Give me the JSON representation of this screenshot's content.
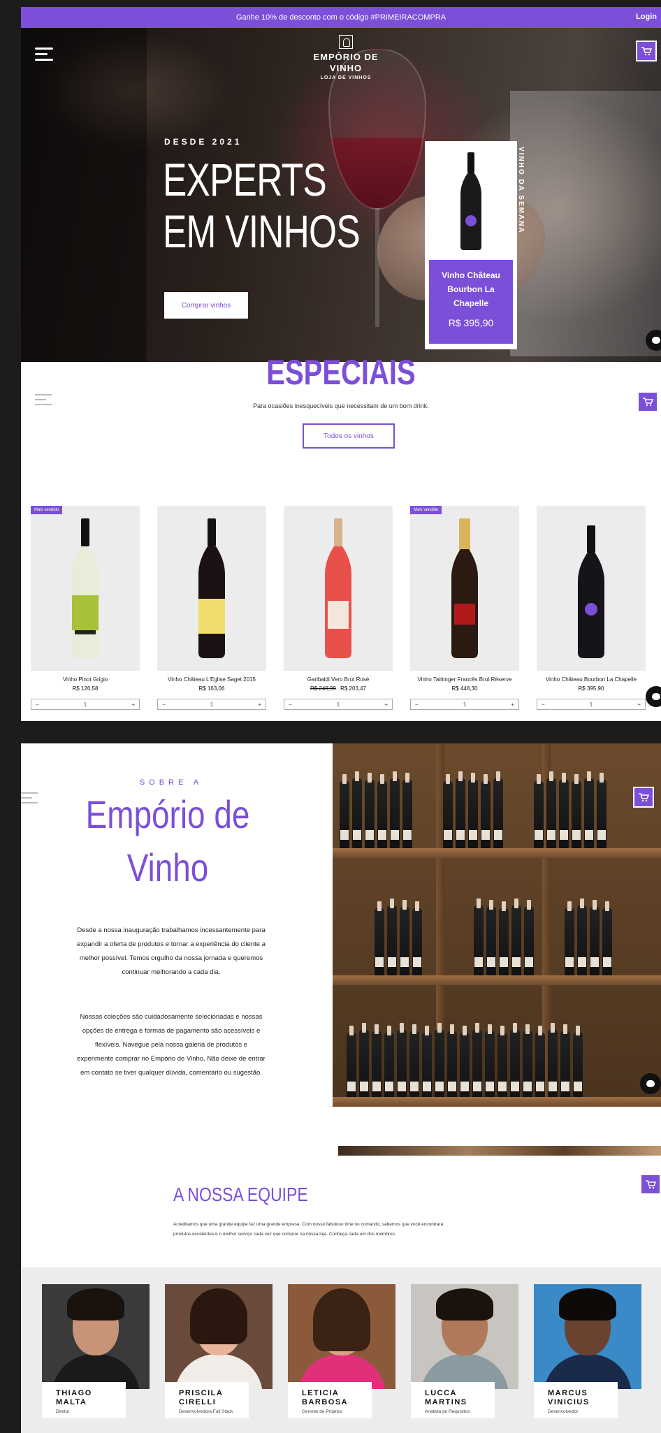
{
  "promo": {
    "text": "Ganhe 10% de desconto com o código #PRIMEIRACOMPRA",
    "login": "Login"
  },
  "brand": {
    "line1": "EMPÓRIO DE",
    "line2": "VINHO",
    "line3": "LOJA DE VINHOS"
  },
  "hero": {
    "eyebrow": "DESDE 2021",
    "title_line1": "EXPERTS",
    "title_line2": "EM VINHOS",
    "cta": "Comprar vinhos"
  },
  "wine_of_week": {
    "label": "VINHO DA SEMANA",
    "name": "Vinho Château Bourbon La Chapelle",
    "price": "R$ 395,90"
  },
  "especiais": {
    "title": "ESPECIAIS",
    "subtitle": "Para ocasiões inesquecíveis que necessitam de um bom drink.",
    "button": "Todos os vinhos",
    "badge": "Mais vendido",
    "products": [
      {
        "name": "Vinho Pinot Grigio",
        "price": "R$ 126,58",
        "old_price": "",
        "qty": "1",
        "badge": true
      },
      {
        "name": "Vinho Château L'Eglise Saget 2015",
        "price": "R$ 163,06",
        "old_price": "",
        "qty": "1",
        "badge": false
      },
      {
        "name": "Garibaldi Vero Brut Rosé",
        "price": "R$ 203,47",
        "old_price": "R$ 249,99",
        "qty": "1",
        "badge": false
      },
      {
        "name": "Vinho Taittinger Francês Brut Réserve",
        "price": "R$ 448,30",
        "old_price": "",
        "qty": "1",
        "badge": true
      },
      {
        "name": "Vinho Château Bourbon La Chapelle",
        "price": "R$ 395,90",
        "old_price": "",
        "qty": "1",
        "badge": false
      }
    ]
  },
  "about": {
    "eyebrow": "SOBRE A",
    "title_line1": "Empório de",
    "title_line2": "Vinho",
    "p1": "Desde a nossa inauguração trabalhamos incessantemente para expandir a oferta de produtos e tornar a experiência do cliente a melhor possível. Temos orgulho da nossa jornada e queremos continuar melhorando a cada dia.",
    "p2": "Nossas coleções são cuidadosamente selecionadas e nossas opções de entrega e formas de pagamento são acessíveis e flexíveis. Navegue pela nossa galeria de produtos e experimente comprar no Empório de Vinho. Não deixe de entrar em contato se tiver qualquer dúvida, comentário ou sugestão."
  },
  "team": {
    "title": "A NOSSA EQUIPE",
    "text": "Acreditamos que uma grande equipe faz uma grande empresa. Com nosso fabuloso time no comando, sabemos que você encontrará produtos excelentes e o melhor serviço cada vez que comprar na nossa loja. Conheça cada um dos membros.",
    "members": [
      {
        "name1": "THIAGO MALTA",
        "name2": "",
        "role": "Diretor"
      },
      {
        "name1": "PRISCILA",
        "name2": "CIRELLI",
        "role": "Desenvolvedora Full Stack"
      },
      {
        "name1": "LETICIA",
        "name2": "BARBOSA",
        "role": "Gerente de Projetos"
      },
      {
        "name1": "LUCCA",
        "name2": "MARTINS",
        "role": "Analista de Requisitos"
      },
      {
        "name1": "MARCUS",
        "name2": "VINICIUS",
        "role": "Desenvolvedor"
      }
    ]
  },
  "colors": {
    "accent": "#7b4fd8",
    "light_bg": "#ececec"
  },
  "icons": [
    "menu-icon",
    "cart-icon",
    "chat-icon",
    "plus-icon",
    "minus-icon"
  ]
}
